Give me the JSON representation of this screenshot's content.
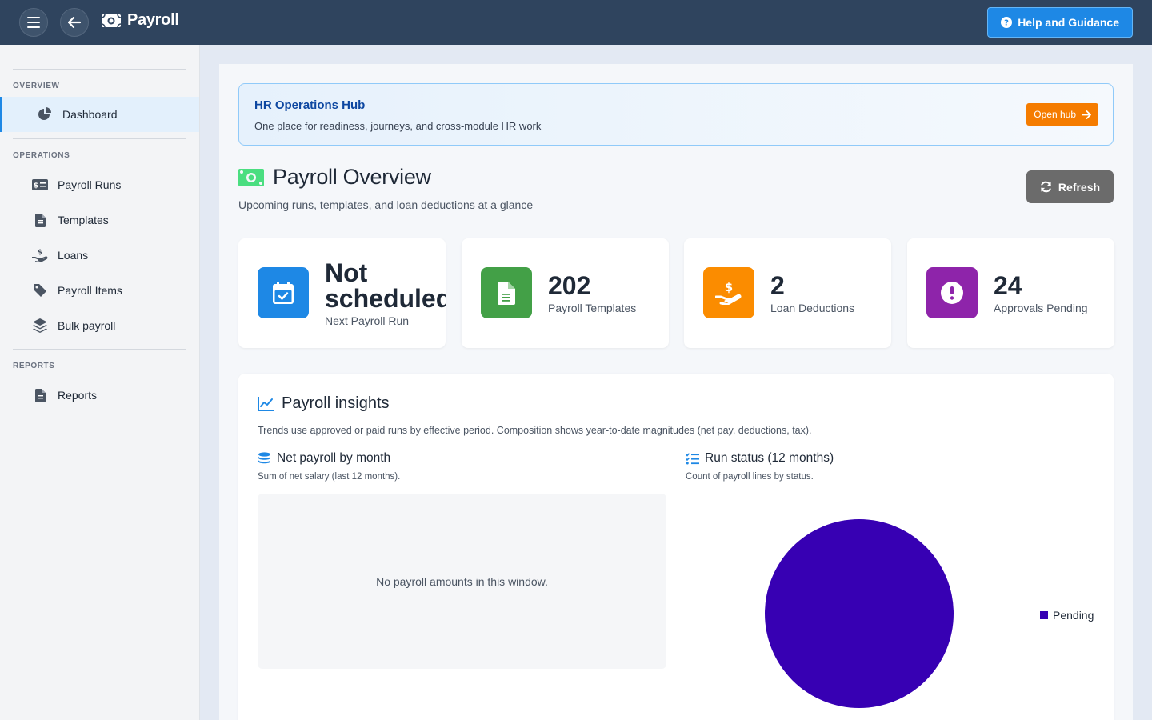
{
  "app": {
    "title": "Payroll",
    "help_label": "Help and Guidance"
  },
  "sidebar": {
    "sections": [
      {
        "label": "OVERVIEW"
      },
      {
        "label": "OPERATIONS"
      },
      {
        "label": "REPORTS"
      }
    ],
    "items": [
      {
        "label": "Dashboard",
        "icon": "chart-pie-icon",
        "active": true
      },
      {
        "label": "Payroll Runs",
        "icon": "money-check-icon"
      },
      {
        "label": "Templates",
        "icon": "file-icon"
      },
      {
        "label": "Loans",
        "icon": "hand-holding-dollar-icon"
      },
      {
        "label": "Payroll Items",
        "icon": "tag-icon"
      },
      {
        "label": "Bulk payroll",
        "icon": "layer-group-icon"
      },
      {
        "label": "Reports",
        "icon": "file-lines-icon"
      }
    ]
  },
  "hub": {
    "title": "HR Operations Hub",
    "subtitle": "One place for readiness, journeys, and cross-module HR work",
    "button_label": "Open hub"
  },
  "overview": {
    "title": "Payroll Overview",
    "subtitle": "Upcoming runs, templates, and loan deductions at a glance",
    "refresh_label": "Refresh"
  },
  "stats": [
    {
      "value_line1": "Not",
      "value_line2": "scheduled",
      "label": "Next Payroll Run",
      "icon": "calendar-check-icon",
      "color": "#1e88e5"
    },
    {
      "value": "202",
      "label": "Payroll Templates",
      "icon": "file-lines-icon",
      "color": "#43a047"
    },
    {
      "value": "2",
      "label": "Loan Deductions",
      "icon": "hand-holding-dollar-icon",
      "color": "#fb8c00"
    },
    {
      "value": "24",
      "label": "Approvals Pending",
      "icon": "exclamation-circle-icon",
      "color": "#8e24aa"
    }
  ],
  "insights": {
    "title": "Payroll insights",
    "description": "Trends use approved or paid runs by effective period. Composition shows year-to-date magnitudes (net pay, deductions, tax).",
    "net_payroll": {
      "title": "Net payroll by month",
      "subtitle": "Sum of net salary (last 12 months).",
      "empty_message": "No payroll amounts in this window."
    },
    "run_status": {
      "title": "Run status (12 months)",
      "subtitle": "Count of payroll lines by status."
    }
  },
  "colors": {
    "topbar": "#2f445e",
    "accent": "#1e88e5",
    "hub_button": "#f57c00",
    "pending": "#3700b3"
  },
  "chart_data": {
    "type": "pie",
    "slices": [
      {
        "label": "Pending",
        "value": 1,
        "color": "#3700b3"
      }
    ],
    "legend_position": "right"
  }
}
